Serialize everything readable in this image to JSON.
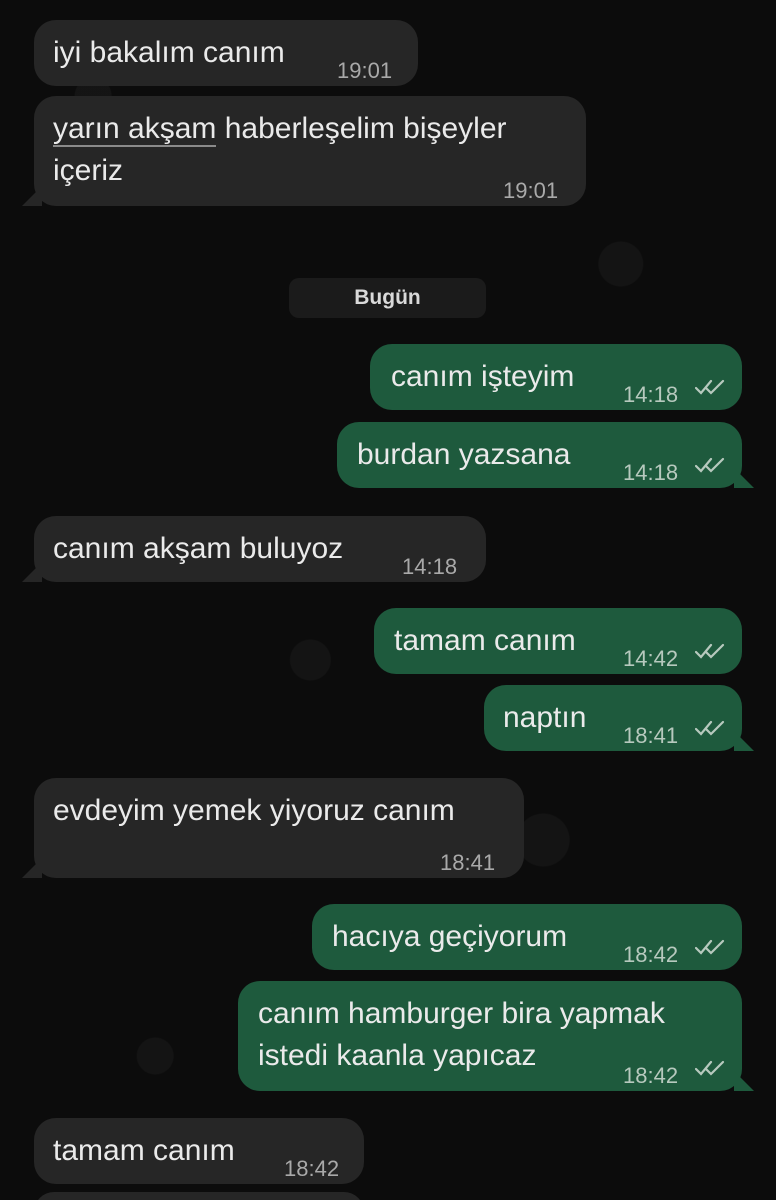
{
  "day_separator": "Bugün",
  "messages": [
    {
      "dir": "in",
      "text": "iyi bakalım canım",
      "time": "19:01"
    },
    {
      "dir": "in",
      "line1_underlined": "yarın akşam",
      "line1_rest": " haberleşelim bişeyler",
      "line2": "içeriz",
      "time": "19:01"
    },
    {
      "dir": "out",
      "text": "canım işteyim",
      "time": "14:18"
    },
    {
      "dir": "out",
      "text": "burdan yazsana",
      "time": "14:18"
    },
    {
      "dir": "in",
      "text": "canım akşam buluyoz",
      "time": "14:18"
    },
    {
      "dir": "out",
      "text": "tamam canım",
      "time": "14:42"
    },
    {
      "dir": "out",
      "text": "naptın",
      "time": "18:41"
    },
    {
      "dir": "in",
      "text": "evdeyim yemek yiyoruz canım",
      "time": "18:41"
    },
    {
      "dir": "out",
      "text": "hacıya geçiyorum",
      "time": "18:42"
    },
    {
      "dir": "out",
      "line1": "canım hamburger bira yapmak",
      "line2": "istedi kaanla yapıcaz",
      "time": "18:42"
    },
    {
      "dir": "in",
      "text": "tamam canım",
      "time": "18:42"
    }
  ],
  "colors": {
    "incoming_bubble": "#262626",
    "outgoing_bubble": "#1e5a3d",
    "background": "#0c0c0c"
  },
  "icons": {
    "read_receipt": "double-check-icon"
  }
}
